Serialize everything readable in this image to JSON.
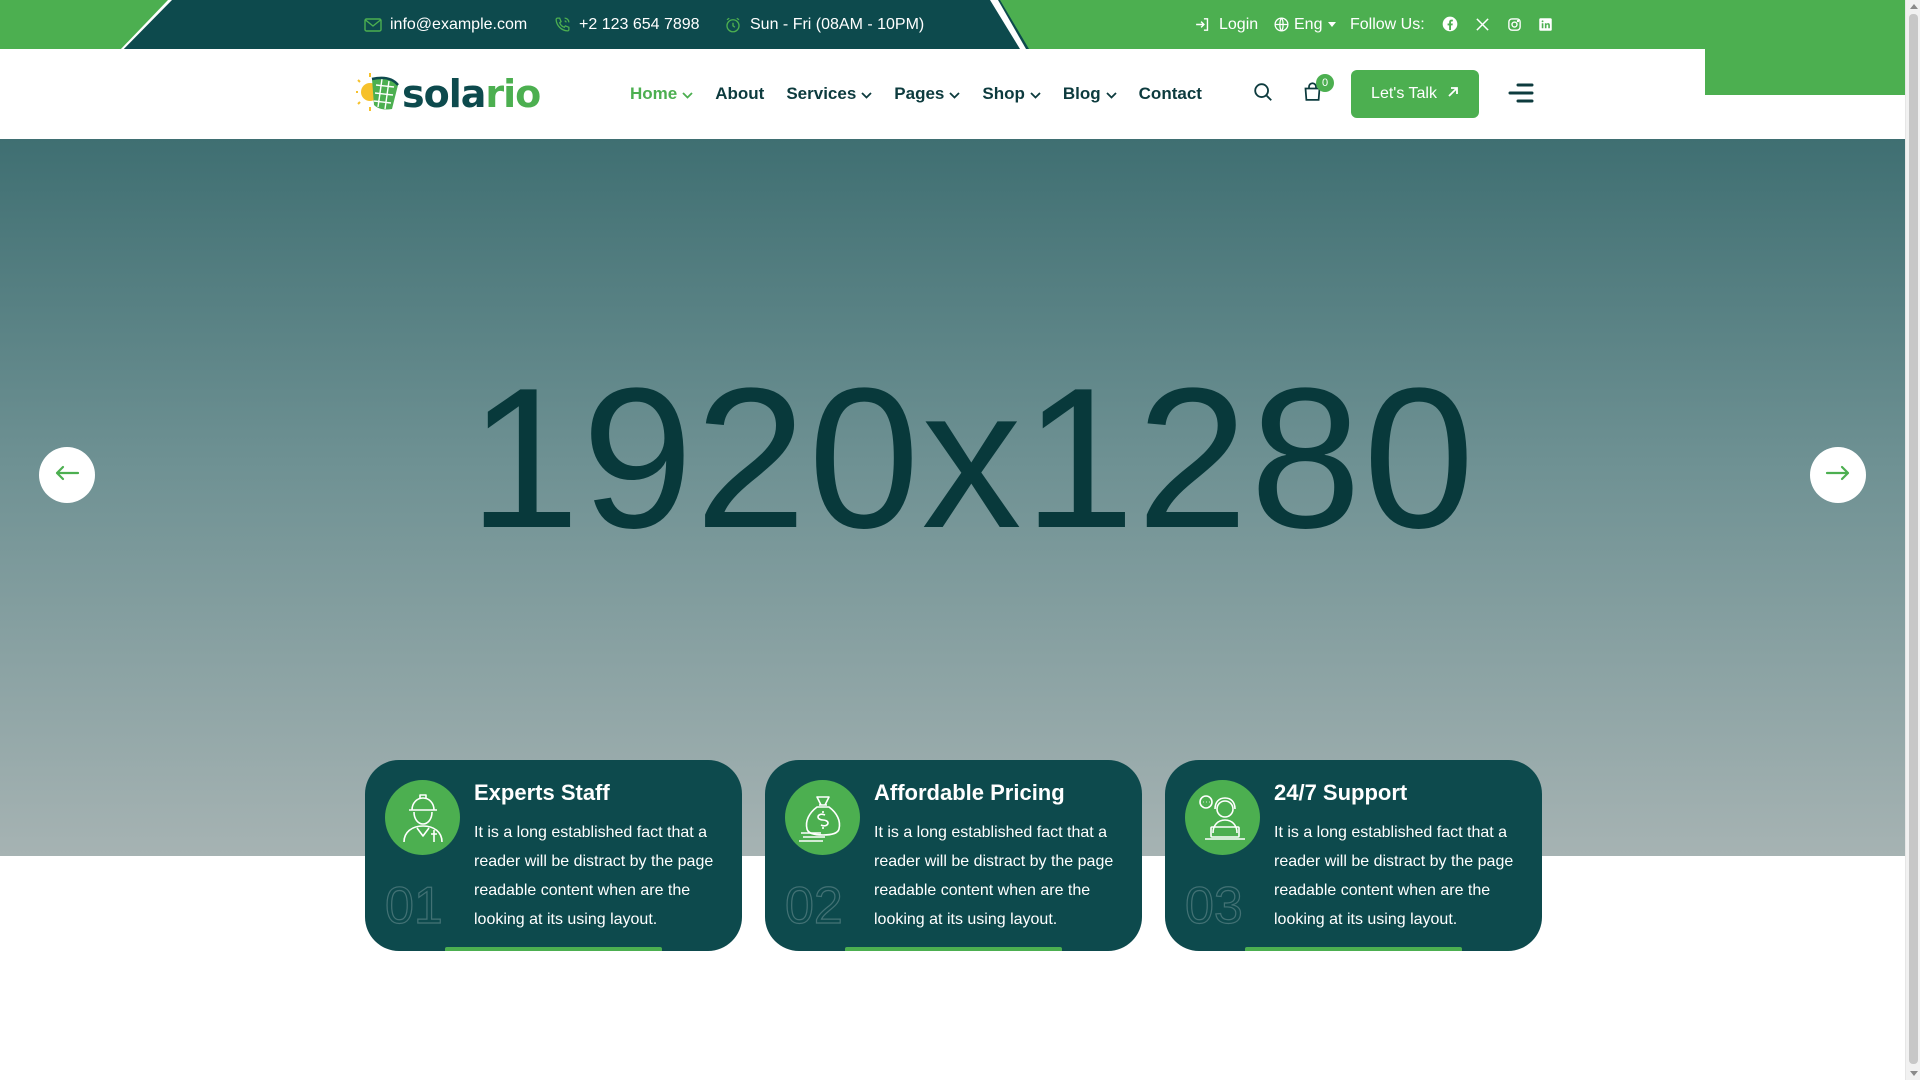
{
  "topbar": {
    "email": "info@example.com",
    "phone": "+2 123 654 7898",
    "hours": "Sun - Fri (08AM - 10PM)",
    "login": "Login",
    "language": "Eng",
    "follow_label": "Follow Us:",
    "socials": [
      "facebook-icon",
      "x-twitter-icon",
      "instagram-icon",
      "linkedin-icon"
    ]
  },
  "header": {
    "logo_text_dark": "sola",
    "logo_text_accent": "rio",
    "nav": [
      {
        "label": "Home",
        "has_dropdown": true,
        "active": true
      },
      {
        "label": "About",
        "has_dropdown": false,
        "active": false
      },
      {
        "label": "Services",
        "has_dropdown": true,
        "active": false
      },
      {
        "label": "Pages",
        "has_dropdown": true,
        "active": false
      },
      {
        "label": "Shop",
        "has_dropdown": true,
        "active": false
      },
      {
        "label": "Blog",
        "has_dropdown": true,
        "active": false
      },
      {
        "label": "Contact",
        "has_dropdown": false,
        "active": false
      }
    ],
    "cart_count": "0",
    "cta_label": "Let's Talk"
  },
  "hero": {
    "placeholder_text": "1920x1280"
  },
  "features": [
    {
      "title": "Experts Staff",
      "description": "It is a long established fact that a reader will be distract by the page readable content when are the looking at its using layout.",
      "number": "01",
      "icon": "engineer-icon"
    },
    {
      "title": "Affordable Pricing",
      "description": "It is a long established fact that a reader will be distract by the page readable content when are the looking at its using layout.",
      "number": "02",
      "icon": "money-bag-icon"
    },
    {
      "title": "24/7 Support",
      "description": "It is a long established fact that a reader will be distract by the page readable content when are the looking at its using layout.",
      "number": "03",
      "icon": "support-agent-icon"
    }
  ],
  "colors": {
    "brand_green": "#4caf50",
    "brand_dark_teal": "#0d4a4d",
    "white": "#ffffff"
  }
}
